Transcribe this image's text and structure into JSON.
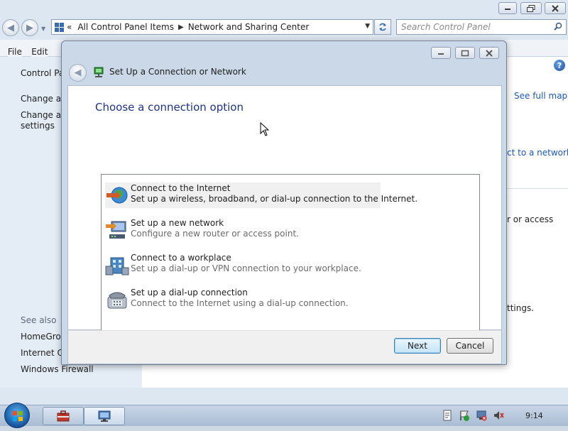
{
  "explorer": {
    "address": {
      "root_chevron": "«",
      "crumbs": [
        "All Control Panel Items",
        "Network and Sharing Center"
      ]
    },
    "search_placeholder": "Search Control Panel",
    "menu": {
      "file": "File",
      "edit": "Edit"
    },
    "left_pane": {
      "home": "Control Pa",
      "task1": "Change ad",
      "task2_line1": "Change ad",
      "task2_line2": "settings",
      "see_also": "See also",
      "link1": "HomeGrou",
      "link2": "Internet Op",
      "link3": "Windows Firewall"
    },
    "main_pane": {
      "see_full_map": "See full map",
      "connect_to_network": "ct to a network",
      "or_access": "r or access",
      "settings": "ttings."
    }
  },
  "dialog": {
    "title": "Set Up a Connection or Network",
    "heading": "Choose a connection option",
    "options": [
      {
        "title": "Connect to the Internet",
        "desc": "Set up a wireless, broadband, or dial-up connection to the Internet.",
        "icon": "globe-icon"
      },
      {
        "title": "Set up a new network",
        "desc": "Configure a new router or access point.",
        "icon": "router-icon"
      },
      {
        "title": "Connect to a workplace",
        "desc": "Set up a dial-up or VPN connection to your workplace.",
        "icon": "workplace-icon"
      },
      {
        "title": "Set up a dial-up connection",
        "desc": "Connect to the Internet using a dial-up connection.",
        "icon": "phone-icon"
      }
    ],
    "next_label": "Next",
    "cancel_label": "Cancel"
  },
  "taskbar": {
    "clock": "9:14"
  },
  "colors": {
    "heading": "#1e3287",
    "link": "#1b58b8",
    "selection": "#f0f0f0"
  }
}
